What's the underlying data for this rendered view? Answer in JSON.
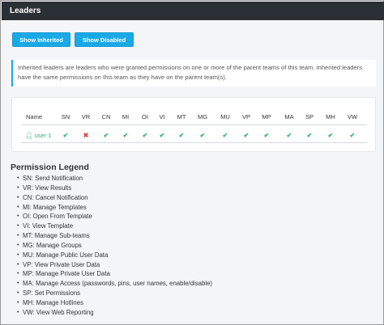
{
  "header": {
    "title": "Leaders"
  },
  "toolbar": {
    "show_inherited_label": "Show Inherited",
    "show_disabled_label": "Show Disabled"
  },
  "info": {
    "text": "Inherited leaders are leaders who were granted permissions on one or more of the parent teams of this team. Inherited leaders have the same permissions on this team as they have on the parent team(s)."
  },
  "table": {
    "name_header": "Name",
    "columns": [
      "SN",
      "VR",
      "CN",
      "MI",
      "OI",
      "VI",
      "MT",
      "MG",
      "MU",
      "VP",
      "MP",
      "MA",
      "SP",
      "MH",
      "VW"
    ],
    "rows": [
      {
        "name": "user 1",
        "permissions": [
          true,
          false,
          true,
          true,
          true,
          true,
          true,
          true,
          true,
          true,
          true,
          true,
          true,
          true,
          true
        ]
      }
    ],
    "check_glyph": "✔",
    "cross_glyph": "✖",
    "check_color": "#2fb36b",
    "cross_color": "#e0434b"
  },
  "legend": {
    "title": "Permission Legend",
    "items": [
      "SN: Send Notification",
      "VR: View Results",
      "CN: Cancel Notification",
      "MI: Manage Templates",
      "OI: Open From Template",
      "VI: View Template",
      "MT: Manage Sub-teams",
      "MG: Manage Groups",
      "MU: Manage Public User Data",
      "VP: View Private User Data",
      "MP: Manage Private User Data",
      "MA: Manage Access (passwords, pins, user names, enable/disable)",
      "SP: Set Permissions",
      "MH: Manage Hotlines",
      "VW: View Web Reporting"
    ]
  },
  "colors": {
    "accent": "#19a9e6",
    "titlebar": "#2b2f36"
  }
}
